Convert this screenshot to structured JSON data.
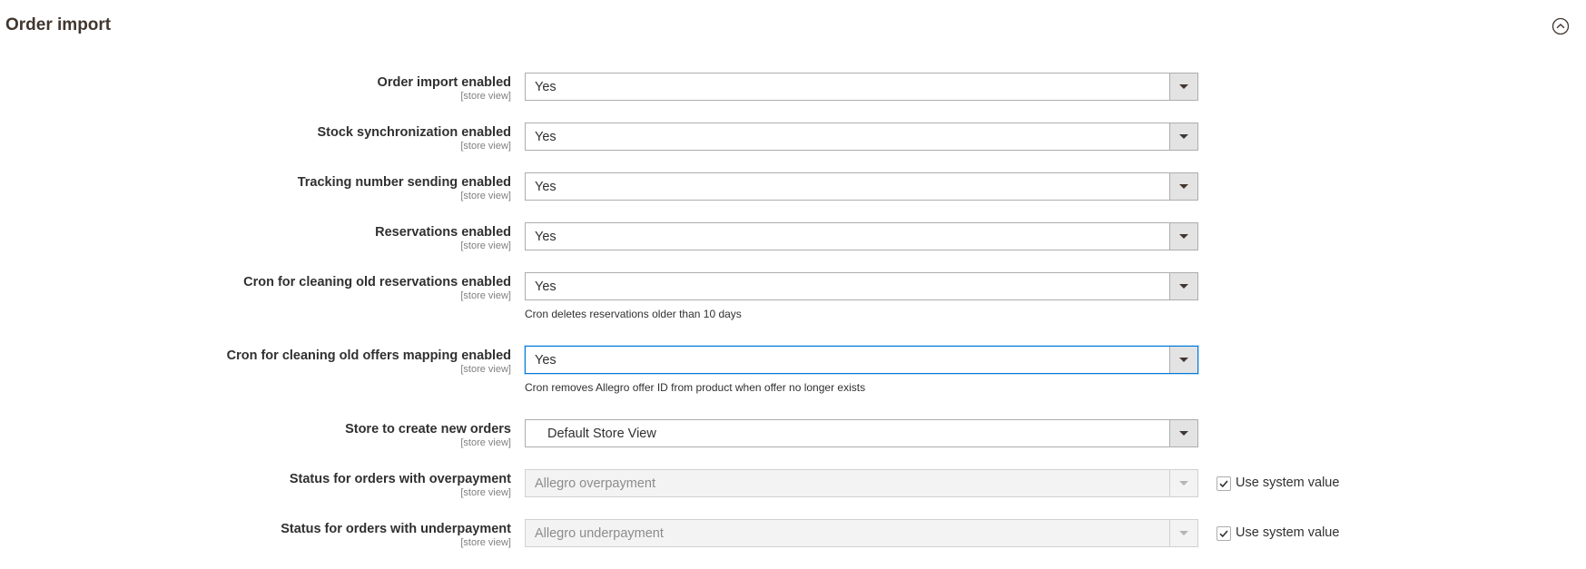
{
  "section": {
    "title": "Order import",
    "toggle_icon": "chevron-up-circle-icon"
  },
  "fields": [
    {
      "label": "Order import enabled",
      "scope": "[store view]",
      "value": "Yes"
    },
    {
      "label": "Stock synchronization enabled",
      "scope": "[store view]",
      "value": "Yes"
    },
    {
      "label": "Tracking number sending enabled",
      "scope": "[store view]",
      "value": "Yes"
    },
    {
      "label": "Reservations enabled",
      "scope": "[store view]",
      "value": "Yes"
    },
    {
      "label": "Cron for cleaning old reservations enabled",
      "scope": "[store view]",
      "value": "Yes",
      "note": "Cron deletes reservations older than 10 days"
    },
    {
      "label": "Cron for cleaning old offers mapping enabled",
      "scope": "[store view]",
      "value": "Yes",
      "note": "Cron removes Allegro offer ID from product when offer no longer exists"
    },
    {
      "label": "Store to create new orders",
      "scope": "[store view]",
      "value": "Default Store View"
    },
    {
      "label": "Status for orders with overpayment",
      "scope": "[store view]",
      "value": "Allegro overpayment",
      "use_system_value": "Use system value",
      "use_system_checked": true
    },
    {
      "label": "Status for orders with underpayment",
      "scope": "[store view]",
      "value": "Allegro underpayment",
      "use_system_value": "Use system value",
      "use_system_checked": true
    }
  ],
  "colors": {
    "focus_border": "#007bdb",
    "text": "#303030",
    "scope_text": "#808080",
    "disabled_bg": "#f3f3f3"
  }
}
